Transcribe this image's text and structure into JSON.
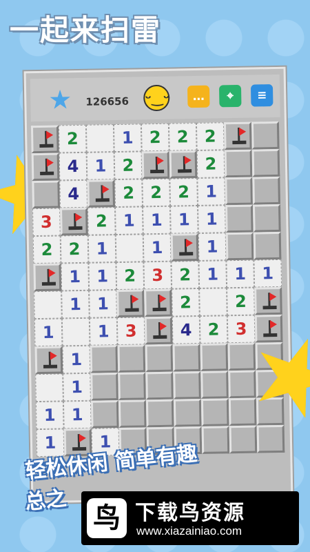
{
  "title": "一起来扫雷",
  "topbar": {
    "score": "126656",
    "icons": [
      "star-icon",
      "smiley-icon",
      "chat-icon",
      "map-pin-icon",
      "menu-list-icon"
    ]
  },
  "board": {
    "rows": [
      [
        "F",
        "2",
        "",
        "1",
        "2",
        "2",
        "2",
        "F",
        "X"
      ],
      [
        "F",
        "4",
        "1",
        "2",
        "F",
        "F",
        "2",
        "X",
        "X"
      ],
      [
        "X",
        "4",
        "F",
        "2",
        "2",
        "2",
        "1",
        "X",
        "X"
      ],
      [
        "3",
        "F",
        "2",
        "1",
        "1",
        "1",
        "1",
        "X",
        "X"
      ],
      [
        "2",
        "2",
        "1",
        "",
        "1",
        "F",
        "1",
        "X",
        "X"
      ],
      [
        "F",
        "1",
        "1",
        "2",
        "3",
        "2",
        "1",
        "1",
        "1"
      ],
      [
        "",
        "1",
        "1",
        "F",
        "F",
        "2",
        "",
        "2",
        "F"
      ],
      [
        "1",
        "",
        "1",
        "3",
        "F",
        "4",
        "2",
        "3",
        "F"
      ],
      [
        "F",
        "1",
        "X",
        "X",
        "X",
        "X",
        "X",
        "X",
        "X"
      ],
      [
        "",
        "1",
        "X",
        "X",
        "X",
        "X",
        "X",
        "X",
        "X"
      ],
      [
        "1",
        "1",
        "X",
        "X",
        "X",
        "X",
        "X",
        "X",
        "X"
      ],
      [
        "1",
        "F",
        "1",
        "X",
        "X",
        "X",
        "X",
        "X",
        "X"
      ]
    ]
  },
  "slogan": {
    "line1": "轻松休闲  简单有趣",
    "line2": "总之"
  },
  "watermark": {
    "logo_glyph": "鸟",
    "name": "下载鸟资源",
    "url": "www.xiazainiao.com"
  },
  "colors": {
    "one": "#3d4fb0",
    "two": "#1c8a3a",
    "three": "#d12f2f",
    "four": "#2a2a8c",
    "flag": "#e32828",
    "background": "#8fc8ef"
  }
}
